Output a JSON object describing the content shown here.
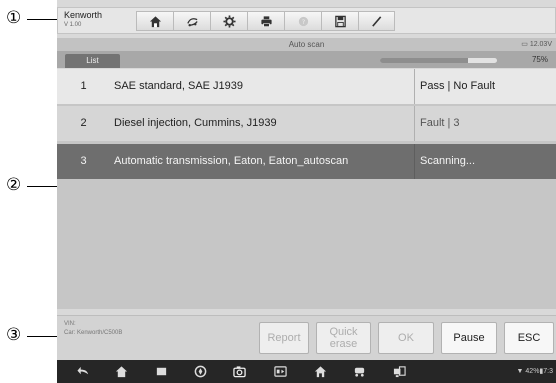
{
  "callouts": [
    "①",
    "②",
    "③"
  ],
  "vehicle": {
    "brand": "Kenworth",
    "version": "V 1.00"
  },
  "toolbar": {
    "buttons": [
      "home-icon",
      "vehicle-swap-icon",
      "settings-icon",
      "print-icon",
      "help-icon",
      "save-icon",
      "data-logging-icon"
    ]
  },
  "title": "Auto scan",
  "battery": "12.03V",
  "tab": "List",
  "progress": {
    "percent_label": "75%",
    "value": 0.75
  },
  "rows": [
    {
      "num": "1",
      "system": "SAE standard, SAE J1939",
      "status": "Pass | No Fault"
    },
    {
      "num": "2",
      "system": "Diesel injection, Cummins, J1939",
      "status": "Fault | 3"
    },
    {
      "num": "3",
      "system": "Automatic transmission, Eaton, Eaton_autoscan",
      "status": "Scanning..."
    }
  ],
  "footer": {
    "vin_label": "VIN:",
    "car_info": "Car: Kenworth/C500B",
    "buttons": {
      "report": "Report",
      "quick_erase_1": "Quick",
      "quick_erase_2": "erase",
      "ok": "OK",
      "pause": "Pause",
      "esc": "ESC"
    }
  },
  "system_status": "42%▮7:3",
  "colors": {
    "selected_row": "#6e6e6e",
    "toolbar_bg": "#e6e6e6"
  }
}
